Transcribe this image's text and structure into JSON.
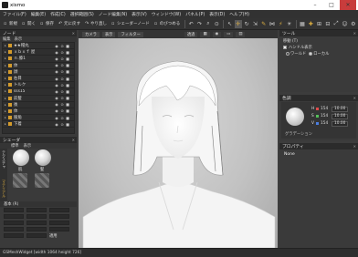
{
  "window": {
    "title": "xismo"
  },
  "menu": [
    "ファイル(F)",
    "編集(E)",
    "作成(C)",
    "選択範囲(S)",
    "ノード編集(N)",
    "表示(V)",
    "ウィンドウ(W)",
    "パネル(P)",
    "表示(D)",
    "ヘルプ(H)"
  ],
  "toolbar": {
    "buttons": [
      "新規",
      "開く",
      "保存",
      "元に戻す",
      "やり直し",
      "シェーダーノード",
      "のびつめる"
    ]
  },
  "node_panel": {
    "title": "ノード",
    "tabs": [
      "編集",
      "表示"
    ],
    "rows": [
      {
        "label": "★★帽丸"
      },
      {
        "label": "ｘｂｘｆ 屋"
      },
      {
        "label": "ｎ.膝1"
      },
      {
        "label": "体"
      },
      {
        "label": "顔"
      },
      {
        "label": "右目"
      },
      {
        "label": "トルク"
      },
      {
        "label": "sss15"
      },
      {
        "label": "前髪"
      },
      {
        "label": "後"
      },
      {
        "label": "体"
      },
      {
        "label": "服角"
      },
      {
        "label": "下着"
      }
    ]
  },
  "shader_panel": {
    "title": "シェーダ",
    "tabs": [
      "標準",
      "表示"
    ],
    "side": [
      "テクスチャ",
      "マテリアル"
    ],
    "spheres": [
      "肌",
      "髪"
    ],
    "props_title": "基本 (R)",
    "apply_label": "適用"
  },
  "viewport": {
    "tabs": [
      "カメラ",
      "表示",
      "フィルター",
      "透過"
    ],
    "tool_icons": [
      "grid-icon",
      "camera-icon",
      "screen-icon",
      "layout-icon"
    ]
  },
  "tool_panel": {
    "title": "ツール",
    "section": "移動 (T)",
    "handle_label": "ハンドル表示",
    "world_label": "ワールド",
    "local_label": "ローカル"
  },
  "color_panel": {
    "title": "色調",
    "rows": [
      {
        "k": "H",
        "v": "154",
        "box": "10.00"
      },
      {
        "k": "S",
        "v": "154",
        "box": "10.00"
      },
      {
        "k": "V",
        "v": "154",
        "box": "10.00"
      }
    ],
    "footer": "グラデーション"
  },
  "property_panel": {
    "title": "プロパティ",
    "value": "None"
  },
  "status": {
    "text": "GSMeshWidget [width 1064 height 726]"
  },
  "colors": {
    "accent": "#e3b341",
    "node_chip": "#d49b2b",
    "viewport_bg": "#c4c4c4"
  }
}
